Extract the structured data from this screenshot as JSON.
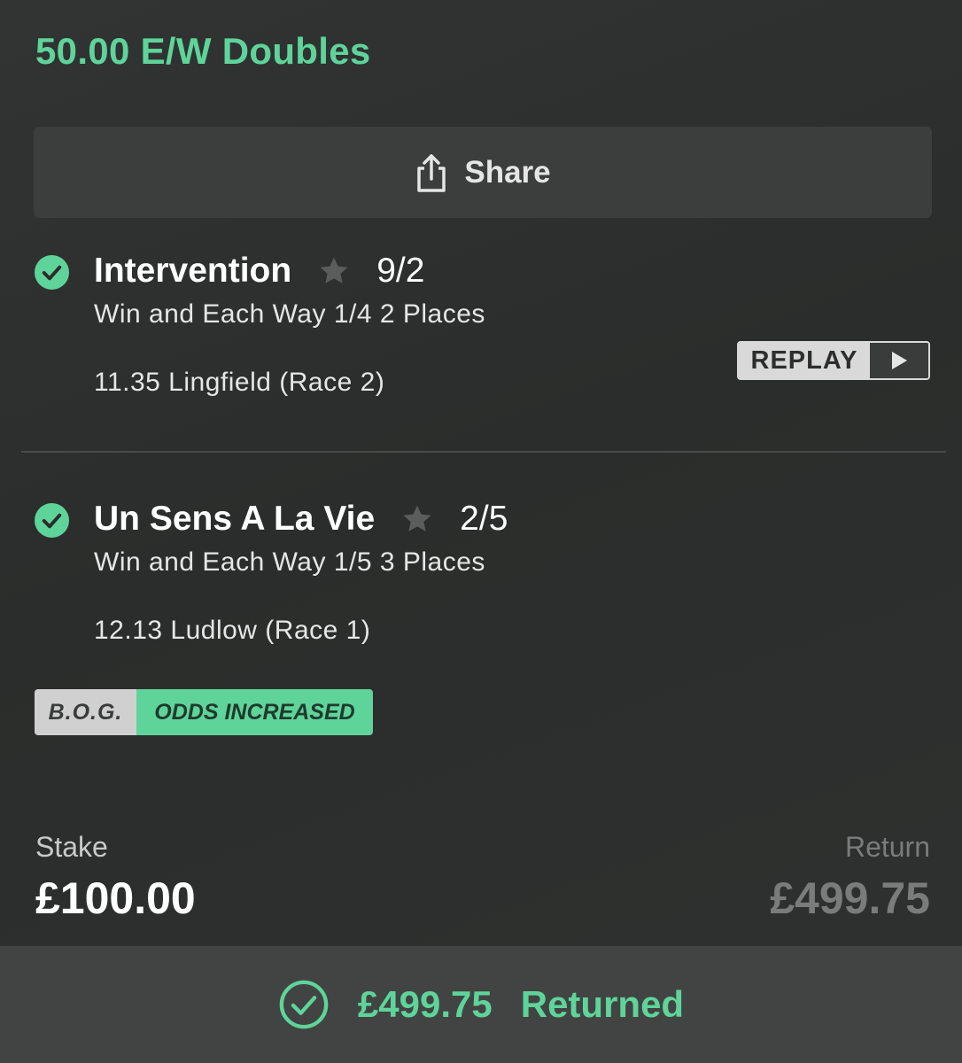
{
  "bet": {
    "title": "50.00 E/W Doubles"
  },
  "share": {
    "label": "Share",
    "icon": "share-icon"
  },
  "selections": [
    {
      "name": "Intervention",
      "odds": "9/2",
      "market": "Win and Each Way 1/4 2 Places",
      "event": "11.35 Lingfield (Race 2)",
      "status_icon": "check-circle-icon",
      "replay_label": "REPLAY"
    },
    {
      "name": "Un Sens A La Vie",
      "odds": "2/5",
      "market": "Win and Each Way 1/5 3 Places",
      "event": "12.13 Ludlow (Race 1)",
      "status_icon": "check-circle-icon"
    }
  ],
  "badge": {
    "bog": "B.O.G.",
    "odds_increased": "ODDS INCREASED"
  },
  "summary": {
    "stake_label": "Stake",
    "stake_value": "£100.00",
    "return_label": "Return",
    "return_value": "£499.75"
  },
  "result": {
    "amount": "£499.75",
    "label": "Returned"
  },
  "colors": {
    "accent": "#5fd49a",
    "background": "#2e302f",
    "panel": "#3c3e3d"
  }
}
